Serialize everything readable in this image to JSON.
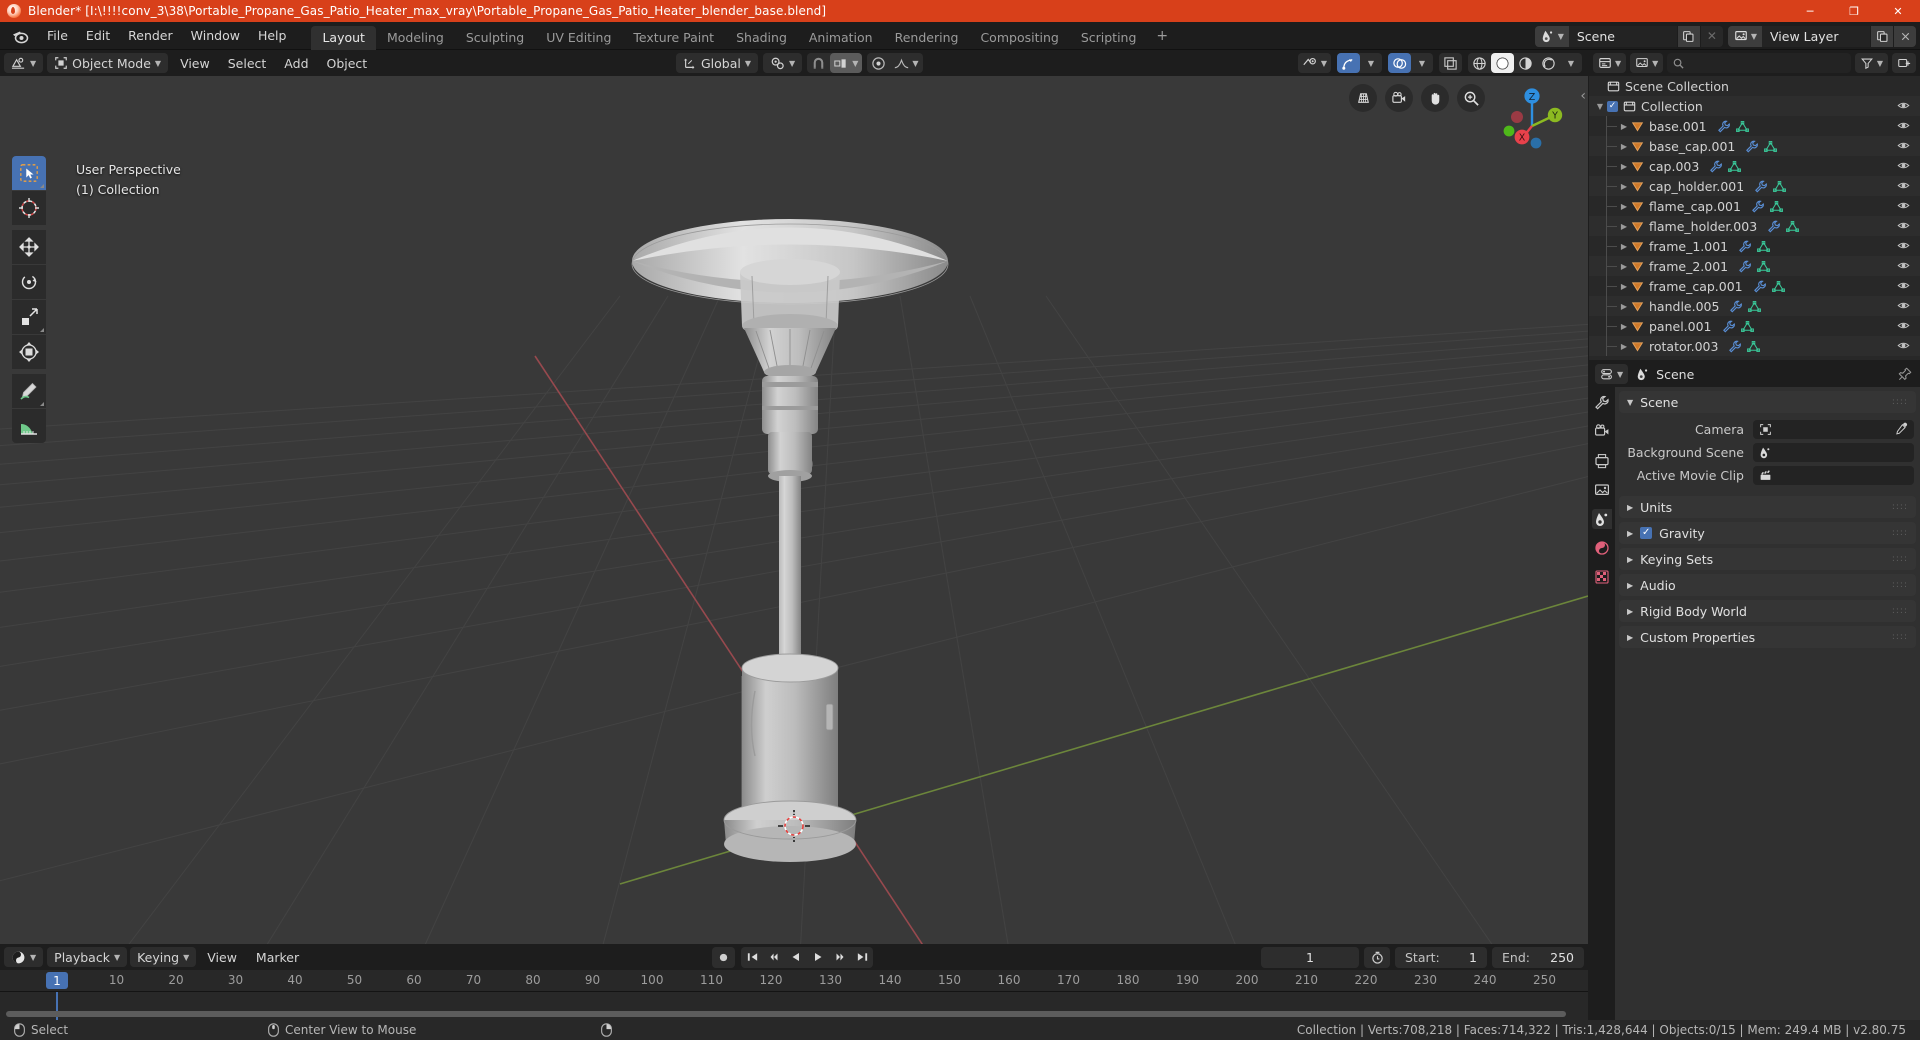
{
  "window": {
    "title": "Blender* [I:\\!!!!conv_3\\38\\Portable_Propane_Gas_Patio_Heater_max_vray\\Portable_Propane_Gas_Patio_Heater_blender_base.blend]",
    "icon": "blender-logo-icon",
    "minimize": "─",
    "maximize": "❐",
    "close": "✕",
    "accent": "#d8401a"
  },
  "topbar": {
    "menus": [
      "File",
      "Edit",
      "Render",
      "Window",
      "Help"
    ],
    "workspaces": [
      {
        "label": "Layout",
        "active": true
      },
      {
        "label": "Modeling",
        "active": false
      },
      {
        "label": "Sculpting",
        "active": false
      },
      {
        "label": "UV Editing",
        "active": false
      },
      {
        "label": "Texture Paint",
        "active": false
      },
      {
        "label": "Shading",
        "active": false
      },
      {
        "label": "Animation",
        "active": false
      },
      {
        "label": "Rendering",
        "active": false
      },
      {
        "label": "Compositing",
        "active": false
      },
      {
        "label": "Scripting",
        "active": false
      }
    ],
    "add_workspace": "+",
    "scene": {
      "icon": "scene-icon",
      "name": "Scene",
      "new_button": "new-scene-icon",
      "unlink_button": "✕"
    },
    "view_layer": {
      "icon": "view-layer-icon",
      "name": "View Layer",
      "new_button": "new-viewlayer-icon",
      "remove_button": "remove-viewlayer-icon"
    }
  },
  "viewport": {
    "header": {
      "editor_type": "editor-type-3dview-icon",
      "mode": "Object Mode",
      "menus": [
        "View",
        "Select",
        "Add",
        "Object"
      ],
      "transform_orientation": "Global",
      "pivot_point": "pivot-point-icon",
      "snap_magnet": "snap-magnet-icon",
      "snap_target": "snap-increment-icon",
      "proportional_edit": "proportional-edit-icon",
      "proportional_falloff": "smooth-falloff-icon"
    },
    "header_right": {
      "visibility": "object-types-visibility-icon",
      "gizmos": "gizmos-icon",
      "overlays": "overlays-icon",
      "xray": "xray-toggle-icon",
      "shading_wireframe": "shading-wireframe-icon",
      "shading_solid": "shading-solid-icon",
      "shading_material": "shading-material-preview-icon",
      "shading_rendered": "shading-rendered-icon"
    },
    "overlay": {
      "perspective": "User Perspective",
      "collection": "(1) Collection"
    },
    "tools": [
      {
        "name": "tweak-select-box-tool",
        "active": true
      },
      {
        "name": "cursor-tool",
        "active": false
      },
      {
        "name": "move-tool",
        "active": false
      },
      {
        "name": "rotate-tool",
        "active": false
      },
      {
        "name": "scale-tool",
        "active": false
      },
      {
        "name": "transform-tool",
        "active": false
      },
      {
        "name": "annotate-tool",
        "active": false
      },
      {
        "name": "measure-tool",
        "active": false
      }
    ],
    "nav_buttons": [
      "toggle-camera-perspective-icon",
      "camera-view-icon",
      "pan-view-icon",
      "zoom-view-icon"
    ],
    "gizmo_axes": [
      {
        "label": "Z",
        "color": "#2e8fe0"
      },
      {
        "label": "Y",
        "color": "#8cba21"
      },
      {
        "label": "X",
        "color": "#e8414b"
      }
    ],
    "sidebar_toggle": "‹"
  },
  "timeline": {
    "editor_type": "editor-type-timeline-icon",
    "menus": [
      {
        "label": "Playback",
        "dropdown": true
      },
      {
        "label": "Keying",
        "dropdown": true
      },
      {
        "label": "View",
        "dropdown": false
      },
      {
        "label": "Marker",
        "dropdown": false
      }
    ],
    "transport": [
      "jump-to-start",
      "jump-to-prev-keyframe",
      "play-reverse",
      "play",
      "jump-to-next-keyframe",
      "jump-to-end"
    ],
    "record": "auto-keying-icon",
    "current_frame": "1",
    "use_preview_range_icon": "preview-range-icon",
    "start_label": "Start:",
    "start_value": "1",
    "end_label": "End:",
    "end_value": "250",
    "ticks": [
      "10",
      "20",
      "30",
      "40",
      "50",
      "60",
      "70",
      "80",
      "90",
      "100",
      "110",
      "120",
      "130",
      "140",
      "150",
      "160",
      "170",
      "180",
      "190",
      "200",
      "210",
      "220",
      "230",
      "240",
      "250"
    ],
    "playhead_label": "1"
  },
  "outliner": {
    "editor_type": "editor-type-outliner-icon",
    "display_mode": "view-layer-mode-icon",
    "filter_icon": "filter-icon",
    "search_placeholder": "",
    "search_icon": "search-icon",
    "new_collection_icon": "new-collection-icon",
    "root": "Scene Collection",
    "collection": "Collection",
    "items": [
      {
        "name": "base.001",
        "icon": "mesh-object-icon",
        "modifier": true,
        "mesh": true
      },
      {
        "name": "base_cap.001",
        "icon": "mesh-object-icon",
        "modifier": true,
        "mesh": true
      },
      {
        "name": "cap.003",
        "icon": "mesh-object-icon",
        "modifier": true,
        "mesh": true
      },
      {
        "name": "cap_holder.001",
        "icon": "mesh-object-icon",
        "modifier": true,
        "mesh": true
      },
      {
        "name": "flame_cap.001",
        "icon": "mesh-object-icon",
        "modifier": true,
        "mesh": true
      },
      {
        "name": "flame_holder.003",
        "icon": "mesh-object-icon",
        "modifier": true,
        "mesh": true
      },
      {
        "name": "frame_1.001",
        "icon": "mesh-object-icon",
        "modifier": true,
        "mesh": true
      },
      {
        "name": "frame_2.001",
        "icon": "mesh-object-icon",
        "modifier": true,
        "mesh": true
      },
      {
        "name": "frame_cap.001",
        "icon": "mesh-object-icon",
        "modifier": true,
        "mesh": true
      },
      {
        "name": "handle.005",
        "icon": "mesh-object-icon",
        "modifier": true,
        "mesh": true
      },
      {
        "name": "panel.001",
        "icon": "mesh-object-icon",
        "modifier": true,
        "mesh": true
      },
      {
        "name": "rotator.003",
        "icon": "mesh-object-icon",
        "modifier": true,
        "mesh": true
      }
    ],
    "visibility_icon": "eye-icon"
  },
  "properties": {
    "editor_type": "editor-type-properties-icon",
    "breadcrumb_icon": "scene-icon",
    "breadcrumb": "Scene",
    "pin_icon": "pin-icon",
    "tabs": [
      {
        "name": "tool-tab",
        "active": false
      },
      {
        "name": "render-tab",
        "active": false
      },
      {
        "name": "output-tab",
        "active": false
      },
      {
        "name": "view-layer-tab",
        "active": false
      },
      {
        "name": "scene-tab",
        "active": true
      },
      {
        "name": "world-tab",
        "active": false
      },
      {
        "name": "texture-tab",
        "active": false
      }
    ],
    "panel_title": "Scene",
    "fields": [
      {
        "label": "Camera",
        "icon": "camera-data-icon",
        "value": "",
        "eyedropper": true
      },
      {
        "label": "Background Scene",
        "icon": "scene-icon",
        "value": "",
        "eyedropper": false
      },
      {
        "label": "Active Movie Clip",
        "icon": "movie-clip-icon",
        "value": "",
        "eyedropper": false
      }
    ],
    "panels": [
      {
        "label": "Units",
        "checkbox": false,
        "checked": false
      },
      {
        "label": "Gravity",
        "checkbox": true,
        "checked": true
      },
      {
        "label": "Keying Sets",
        "checkbox": false,
        "checked": false
      },
      {
        "label": "Audio",
        "checkbox": false,
        "checked": false
      },
      {
        "label": "Rigid Body World",
        "checkbox": false,
        "checked": false
      },
      {
        "label": "Custom Properties",
        "checkbox": false,
        "checked": false
      }
    ]
  },
  "statusbar": {
    "mouse_left_action": "Select",
    "mouse_middle_action": "Center View to Mouse",
    "stats": "Collection | Verts:708,218 | Faces:714,322 | Tris:1,428,644 | Objects:0/15 | Mem: 249.4 MB | v2.80.75"
  }
}
